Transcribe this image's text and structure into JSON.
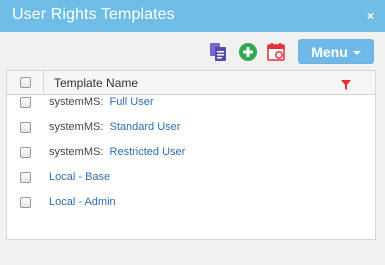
{
  "dialog": {
    "title": "User Rights Templates",
    "close_glyph": "×"
  },
  "toolbar": {
    "icons": [
      "copy-icon",
      "add-icon",
      "calendar-icon"
    ],
    "menu_label": "Menu"
  },
  "grid": {
    "column_header": "Template Name",
    "rows": [
      {
        "prefix": "systemMS:",
        "name": "Full User"
      },
      {
        "prefix": "systemMS:",
        "name": "Standard User"
      },
      {
        "prefix": "systemMS:",
        "name": "Restricted User"
      },
      {
        "prefix": "",
        "name": "Local - Base"
      },
      {
        "prefix": "",
        "name": "Local - Admin"
      }
    ]
  },
  "colors": {
    "titlebar": "#6dbde6",
    "menu_button": "#6fb8e8",
    "link": "#2f6db3",
    "filter": "#e0303a",
    "add": "#2fa84f",
    "copy": "#7b63c9"
  }
}
